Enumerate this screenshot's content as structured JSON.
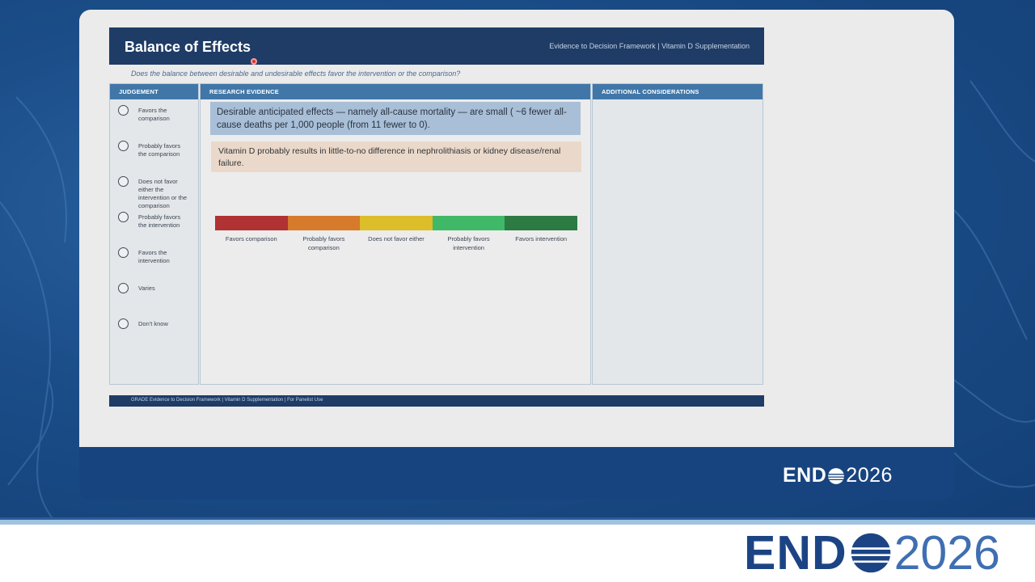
{
  "slide": {
    "title": "Balance of Effects",
    "header_subtitle": "Evidence to Decision Framework  |  Vitamin D Supplementation",
    "question": "Does the balance between desirable and undesirable effects favor the intervention or the comparison?",
    "columns": {
      "judgement": "JUDGEMENT",
      "research_evidence": "RESEARCH EVIDENCE",
      "additional_considerations": "ADDITIONAL CONSIDERATIONS"
    },
    "options": [
      "Favors the comparison",
      "Probably favors the comparison",
      "Does not favor either the intervention or the comparison",
      "Probably favors the intervention",
      "Favors the intervention",
      "Varies",
      "Don't know"
    ],
    "evidence": {
      "box1": "Desirable anticipated effects — namely all-cause mortality — are small ( ~6 fewer all-cause deaths per 1,000 people (from 11 fewer to 0).",
      "box2": "Vitamin D probably results in little-to-no difference in nephrolithiasis or kidney disease/renal failure."
    },
    "scale": {
      "segments": [
        {
          "label": "Favors comparison",
          "color": "#b03232"
        },
        {
          "label": "Probably favors comparison",
          "color": "#d67a2c"
        },
        {
          "label": "Does not favor either",
          "color": "#dcbd2a"
        },
        {
          "label": "Probably favors intervention",
          "color": "#3fb968"
        },
        {
          "label": "Favors intervention",
          "color": "#2c7b42"
        }
      ]
    },
    "footer": "GRADE Evidence to Decision Framework  |  Vitamin D Supplementation  |  For Panelist Use"
  },
  "branding": {
    "logo_word": "END",
    "logo_year": "2026"
  },
  "colors": {
    "header": "#1e3c66",
    "column_head": "#4177a8",
    "brand_blue": "#1c4485"
  }
}
